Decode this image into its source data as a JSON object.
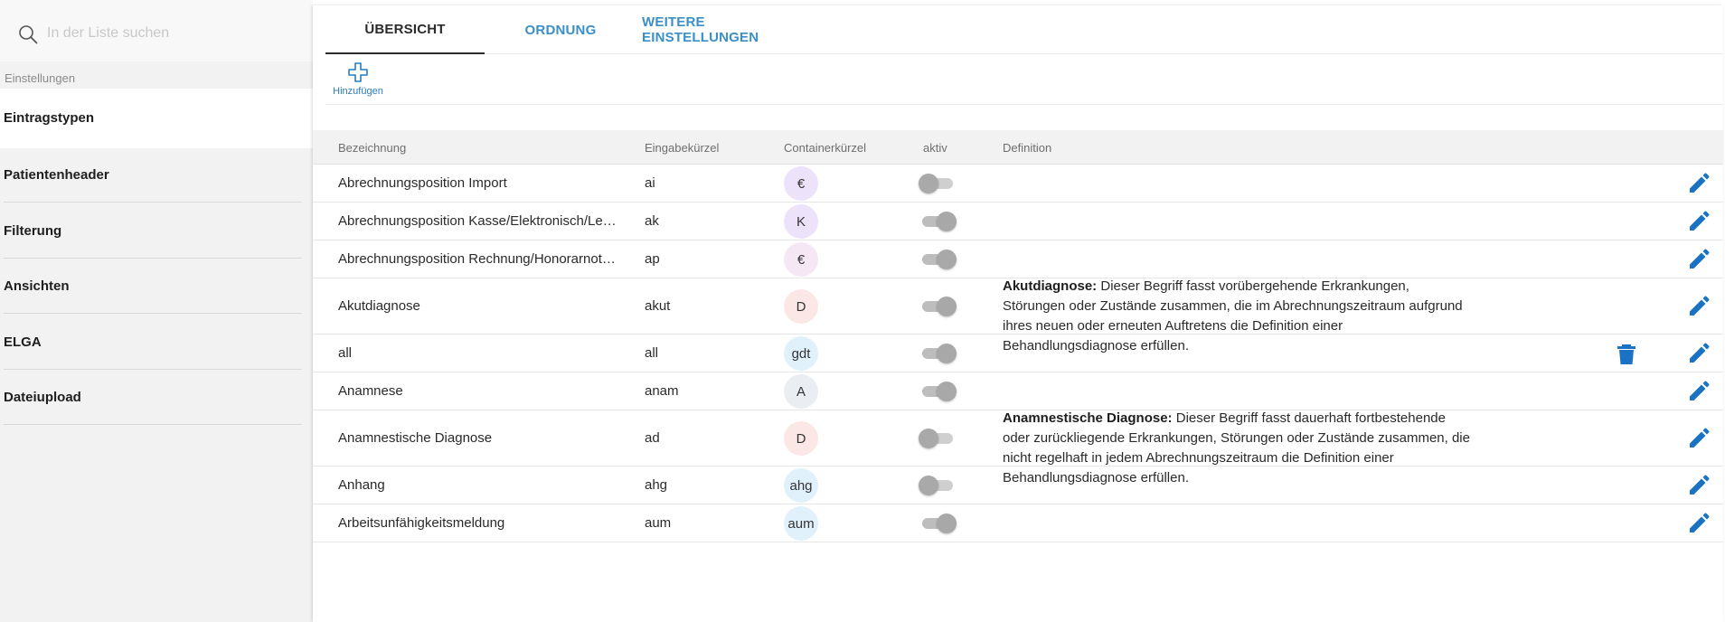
{
  "search": {
    "placeholder": "In der Liste suchen",
    "icon": "search-icon"
  },
  "sidebar": {
    "group_label": "Einstellungen",
    "items": [
      {
        "label": "Eintragstypen",
        "active": true
      },
      {
        "label": "Patientenheader"
      },
      {
        "label": "Filterung"
      },
      {
        "label": "Ansichten"
      },
      {
        "label": "ELGA"
      },
      {
        "label": "Dateiupload"
      }
    ]
  },
  "tabs": [
    {
      "label": "ÜBERSICHT",
      "active": true
    },
    {
      "label": "ORDNUNG"
    },
    {
      "label": "WEITERE EINSTELLUNGEN"
    }
  ],
  "toolbar": {
    "add_label": "Hinzufügen",
    "add_icon": "plus-icon"
  },
  "table": {
    "headers": [
      "Bezeichnung",
      "Eingabekürzel",
      "Containerkürzel",
      "aktiv",
      "Definition"
    ],
    "rows": [
      {
        "name": "Abrechnungsposition Import",
        "short": "ai",
        "badge": "€",
        "badge_bg": "#ece3fb",
        "active": false,
        "def_title": "",
        "def_text": "",
        "deletable": false
      },
      {
        "name": "Abrechnungsposition Kasse/Elektronisch/Le…",
        "short": "ak",
        "badge": "K",
        "badge_bg": "#ece3fb",
        "active": true,
        "def_title": "",
        "def_text": "",
        "deletable": false
      },
      {
        "name": "Abrechnungsposition Rechnung/Honorarnot…",
        "short": "ap",
        "badge": "€",
        "badge_bg": "#f6e7f5",
        "active": true,
        "def_title": "",
        "def_text": "",
        "deletable": false
      },
      {
        "name": "Akutdiagnose",
        "short": "akut",
        "badge": "D",
        "badge_bg": "#fbe8e6",
        "active": true,
        "def_title": "Akutdiagnose:",
        "def_text": " Dieser Begriff fasst vorübergehende Erkrankungen, Störungen oder Zustände zusammen, die im Abrechnungszeitraum aufgrund ihres neuen oder erneuten Auftretens die Definition einer Behandlungsdiagnose erfüllen.",
        "deletable": false
      },
      {
        "name": "all",
        "short": "all",
        "badge": "gdt",
        "badge_bg": "#e1f1fc",
        "active": true,
        "def_title": "",
        "def_text": "",
        "deletable": true
      },
      {
        "name": "Anamnese",
        "short": "anam",
        "badge": "A",
        "badge_bg": "#eaedf2",
        "active": true,
        "def_title": "",
        "def_text": "",
        "deletable": false
      },
      {
        "name": "Anamnestische Diagnose",
        "short": "ad",
        "badge": "D",
        "badge_bg": "#fbe8e6",
        "active": false,
        "def_title": "Anamnestische Diagnose:",
        "def_text": " Dieser Begriff fasst dauerhaft fortbestehende oder zurückliegende Erkrankungen, Störungen oder Zustände zusammen, die nicht regelhaft in jedem Abrechnungszeitraum die Definition einer Behandlungsdiagnose erfüllen.",
        "deletable": false
      },
      {
        "name": "Anhang",
        "short": "ahg",
        "badge": "ahg",
        "badge_bg": "#e1f1fc",
        "active": false,
        "def_title": "",
        "def_text": "",
        "deletable": false
      },
      {
        "name": "Arbeitsunfähigkeitsmeldung",
        "short": "aum",
        "badge": "aum",
        "badge_bg": "#e1f1fc",
        "active": true,
        "def_title": "",
        "def_text": "",
        "deletable": false
      }
    ]
  },
  "colors": {
    "accent": "#2a7bbd",
    "edit_icon": "#1a73c2",
    "delete_icon": "#1a73c2"
  }
}
